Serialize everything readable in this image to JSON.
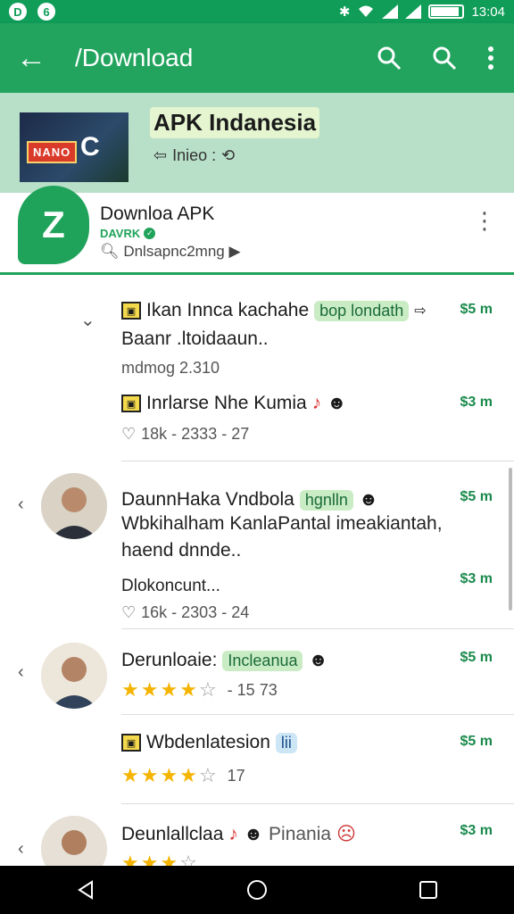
{
  "statusbar": {
    "left_icons": [
      "D",
      "6"
    ],
    "time": "13:04",
    "icons": [
      "bluetooth-icon",
      "wifi-icon",
      "signal-icon",
      "battery-icon"
    ]
  },
  "appbar": {
    "back_icon": "←",
    "title": "/Download"
  },
  "banner": {
    "title": "APK Indanesia",
    "subtitle": "Inieo : ",
    "thumb_badge": "NANO",
    "thumb_letter": "C"
  },
  "channel": {
    "logo_letter": "Z",
    "name": "Downloa APK",
    "tag": "DAVRK",
    "meta": "Dnlsapnc2mng"
  },
  "items": [
    {
      "title": "Ikan Innca kachahe",
      "pill": "bop londath",
      "price": "$5 m",
      "body": "Baanr .ltoidaaun..",
      "muted": "mdmog 2.310"
    },
    {
      "title": "Inrlarse Nhe Kumia",
      "price": "$3 m",
      "stats": "18k - 2333 - 27"
    },
    {
      "title": "DaunnHaka Vndbola",
      "pill": "hgnlln",
      "price": "$5 m",
      "body_1": "Wbkihalham KanlaPantal imeakiantah,",
      "body_2": "haend dnnde..",
      "muted": "Dlokoncunt...",
      "price2": "$3 m",
      "stats": "16k - 2303 - 24"
    },
    {
      "title": "Derunloaie:",
      "pill": "Incleanua",
      "price": "$5 m",
      "rating_count": "- 15 73"
    },
    {
      "title": "Wbdenlatesion",
      "pill": "lii",
      "price": "$5 m",
      "rating_count": "17"
    },
    {
      "title": "Deunlallclaa",
      "pill": "Pinania",
      "price": "$3 m"
    }
  ]
}
